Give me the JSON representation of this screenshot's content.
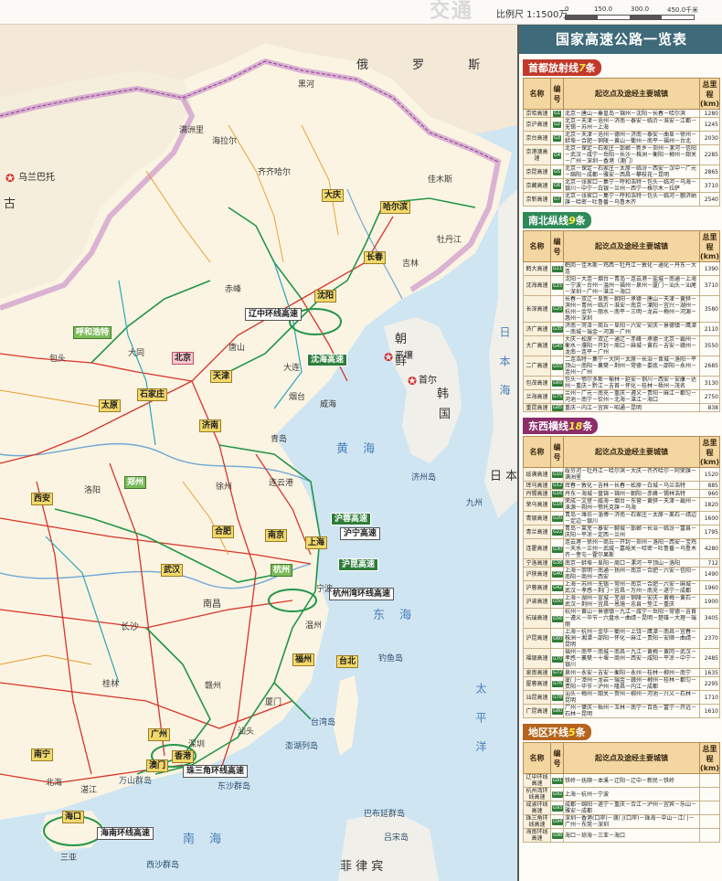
{
  "header": {
    "scale_label": "比例尺 1:1500万",
    "scale_ticks": [
      "0",
      "150.0",
      "300.0",
      "450.0千米"
    ],
    "ghost_text": "交通"
  },
  "map": {
    "countries": [
      {
        "id": "russia",
        "text": "俄 罗 斯"
      },
      {
        "id": "mongolia_fragment",
        "text": "古"
      },
      {
        "id": "korea_n",
        "text": "朝"
      },
      {
        "id": "korea_n2",
        "text": "鲜"
      },
      {
        "id": "korea_s",
        "text": "韩"
      },
      {
        "id": "korea_s2",
        "text": "国"
      },
      {
        "id": "philippines",
        "text": "菲 律 宾"
      },
      {
        "id": "japan_frag",
        "text": "日 本"
      }
    ],
    "seas": [
      {
        "id": "yellow_sea",
        "text": "黄 海"
      },
      {
        "id": "east_sea",
        "text": "东 海"
      },
      {
        "id": "south_sea",
        "text": "南 海"
      },
      {
        "id": "pacific",
        "text": "太 平 洋"
      },
      {
        "id": "japan_sea",
        "text": "日 本 海"
      }
    ],
    "capitals": [
      {
        "id": "ulaanbaatar",
        "text": "乌兰巴托"
      },
      {
        "id": "pyongyang",
        "text": "平壤"
      },
      {
        "id": "seoul",
        "text": "首尔"
      }
    ],
    "cities_boxed": [
      {
        "id": "harbin",
        "text": "哈尔滨"
      },
      {
        "id": "changchun",
        "text": "长春"
      },
      {
        "id": "shenyang",
        "text": "沈阳"
      },
      {
        "id": "huhehaote",
        "text": "呼和浩特"
      },
      {
        "id": "beijing",
        "text": "北京"
      },
      {
        "id": "tianjin",
        "text": "天津"
      },
      {
        "id": "shijiazhuang",
        "text": "石家庄"
      },
      {
        "id": "taiyuan",
        "text": "太原"
      },
      {
        "id": "jinan",
        "text": "济南"
      },
      {
        "id": "zhengzhou",
        "text": "郑州"
      },
      {
        "id": "xian",
        "text": "西安"
      },
      {
        "id": "hefei",
        "text": "合肥"
      },
      {
        "id": "nanjing",
        "text": "南京"
      },
      {
        "id": "shanghai",
        "text": "上海"
      },
      {
        "id": "hangzhou",
        "text": "杭州"
      },
      {
        "id": "wuhan",
        "text": "武汉"
      },
      {
        "id": "nanchang",
        "text": "南昌"
      },
      {
        "id": "changsha",
        "text": "长沙"
      },
      {
        "id": "fuzhou",
        "text": "福州"
      },
      {
        "id": "taibei",
        "text": "台北"
      },
      {
        "id": "guangzhou",
        "text": "广州"
      },
      {
        "id": "hongkong",
        "text": "香港"
      },
      {
        "id": "macau",
        "text": "澳门"
      },
      {
        "id": "nanning",
        "text": "南宁"
      },
      {
        "id": "haikou",
        "text": "海口"
      },
      {
        "id": "daqing",
        "text": "大庆"
      },
      {
        "id": "dalian",
        "text": "大连"
      },
      {
        "id": "qingdao",
        "text": "青岛"
      }
    ],
    "expressways": [
      {
        "id": "huyu",
        "text": "沪蓉高速"
      },
      {
        "id": "huning",
        "text": "沪宁高速"
      },
      {
        "id": "hukun",
        "text": "沪昆高速"
      },
      {
        "id": "hzwan",
        "text": "杭州湾环线高速"
      },
      {
        "id": "liaozhong",
        "text": "辽中环线高速"
      },
      {
        "id": "zhusanjiao",
        "text": "珠三角环线高速"
      },
      {
        "id": "hainan",
        "text": "海南环线高速"
      },
      {
        "id": "shenhai",
        "text": "沈海高速"
      }
    ],
    "places": [
      {
        "id": "heihe",
        "text": "黑河"
      },
      {
        "id": "qiqihaer",
        "text": "齐齐哈尔"
      },
      {
        "id": "manzhouli",
        "text": "满洲里"
      },
      {
        "id": "hailaer",
        "text": "海拉尔"
      },
      {
        "id": "jiamusi",
        "text": "佳木斯"
      },
      {
        "id": "mudanjiang",
        "text": "牡丹江"
      },
      {
        "id": "jilin",
        "text": "吉林"
      },
      {
        "id": "chifeng",
        "text": "赤峰"
      },
      {
        "id": "baotou",
        "text": "包头"
      },
      {
        "id": "datong",
        "text": "大同"
      },
      {
        "id": "tangshan",
        "text": "唐山"
      },
      {
        "id": "yantai",
        "text": "烟台"
      },
      {
        "id": "weihai",
        "text": "威海"
      },
      {
        "id": "lianyungang",
        "text": "连云港"
      },
      {
        "id": "xuzhou",
        "text": "徐州"
      },
      {
        "id": "luoyang",
        "text": "洛阳"
      },
      {
        "id": "ningbo",
        "text": "宁波"
      },
      {
        "id": "wenzhou",
        "text": "温州"
      },
      {
        "id": "xiamen",
        "text": "厦门"
      },
      {
        "id": "shantou",
        "text": "汕头"
      },
      {
        "id": "shenzhen",
        "text": "深圳"
      },
      {
        "id": "zhanjiang",
        "text": "湛江"
      },
      {
        "id": "beihai",
        "text": "北海"
      },
      {
        "id": "guilin",
        "text": "桂林"
      },
      {
        "id": "ganzhou",
        "text": "赣州"
      },
      {
        "id": "taiwan_island",
        "text": "台湾岛"
      },
      {
        "id": "penghu",
        "text": "澎湖列岛"
      },
      {
        "id": "dongsha",
        "text": "东沙群岛"
      },
      {
        "id": "wanshan",
        "text": "万山群岛"
      },
      {
        "id": "xisha",
        "text": "西沙群岛"
      },
      {
        "id": "lvsong",
        "text": "吕宋岛"
      },
      {
        "id": "diaoyu",
        "text": "钓鱼岛"
      },
      {
        "id": "jeju",
        "text": "济州岛"
      },
      {
        "id": "jiuzhou",
        "text": "九州"
      },
      {
        "id": "sanya",
        "text": "三亚"
      },
      {
        "id": "baliss",
        "text": "巴布延群岛"
      }
    ]
  },
  "panel": {
    "title": "国家高速公路一览表",
    "columns": {
      "name": "名称",
      "code": "编号",
      "route": "起讫点及途经主要城镇",
      "length": "总里程(km)"
    },
    "sections": [
      {
        "id": "radial",
        "head_prefix": "首都放射线",
        "head_count": "7",
        "head_suffix": "条",
        "rows": [
          {
            "name": "京哈高速",
            "code": "G1",
            "route": "北京－唐山－秦皇岛－锦州－沈阳－长春－哈尔滨",
            "length": "1280"
          },
          {
            "name": "京沪高速",
            "code": "G2",
            "route": "北京－天津－沧州－济南－泰安－临沂－淮安－江都－无锡－苏州－上海",
            "length": "1245"
          },
          {
            "name": "京台高速",
            "code": "G3",
            "route": "北京－天津－沧州－德州－济南－泰安－曲阜－徐州－蚌埠－合肥－铜陵－黄山－衢州－南平－福州－台北",
            "length": "2030"
          },
          {
            "name": "京港澳高速",
            "code": "G4",
            "route": "北京－保定－石家庄－邯郸－新乡－郑州－漯河－信阳－武汉－咸宁－岳阳－长沙－株洲－衡阳－郴州－韶关－广州－深圳－香港（澳门）",
            "length": "2285"
          },
          {
            "name": "京昆高速",
            "code": "G5",
            "route": "北京－保定－石家庄－太原－临汾－西安－汉中－广元－绵阳－成都－雅安－西昌－攀枝花－昆明",
            "length": "2865"
          },
          {
            "name": "京藏高速",
            "code": "G6",
            "route": "北京－张家口－集宁－呼和浩特－包头－临河－乌海－银川－中宁－白银－兰州－西宁－格尔木－拉萨",
            "length": "3710"
          },
          {
            "name": "京新高速",
            "code": "G7",
            "route": "北京－张家口－集宁－呼和浩特－包头－临河－额济纳旗－哈密－吐鲁番－乌鲁木齐",
            "length": "2540"
          }
        ]
      },
      {
        "id": "ns",
        "head_prefix": "南北纵线",
        "head_count": "9",
        "head_suffix": "条",
        "rows": [
          {
            "name": "鹤大高速",
            "code": "G11",
            "route": "鹤岗－佳木斯－鸡西－牡丹江－敦化－通化－丹东－大连",
            "length": "1390"
          },
          {
            "name": "沈海高速",
            "code": "G15",
            "route": "沈阳－大连－烟台－青岛－连云港－盐城－南通－上海－宁波－台州－温州－福州－泉州－厦门－汕头－汕尾－深圳－广州－湛江－海口",
            "length": "3710"
          },
          {
            "name": "长深高速",
            "code": "G25",
            "route": "长春－双辽－阜新－朝阳－承德－唐山－天津－黄骅－滨州－青州－临沂－淮安－南京－溧阳－宜兴－湖州－杭州－金华－丽水－南平－三明－龙岩－梅州－河源－惠州－深圳",
            "length": "3580"
          },
          {
            "name": "济广高速",
            "code": "G35",
            "route": "济南－菏泽－商丘－阜阳－六安－安庆－景德镇－鹰潭－南城－瑞金－河源－广州",
            "length": "2110"
          },
          {
            "name": "大广高速",
            "code": "G45",
            "route": "大庆－松原－双辽－通辽－赤峰－承德－北京－霸州－衡水－濮阳－开封－周口－麻城－黄石－吉安－赣州－龙南－连平－广州",
            "length": "3550"
          },
          {
            "name": "二广高速",
            "code": "G55",
            "route": "二连浩特－集宁－大同－太原－长治－晋城－洛阳－平顶山－南阳－襄樊－荆州－常德－娄底－邵阳－永州－连州－广州",
            "length": "2685"
          },
          {
            "name": "包茂高速",
            "code": "G65",
            "route": "包头－鄂尔多斯－榆林－延安－铜川－西安－安康－达州－重庆－黔江－吉首－怀化－桂林－梧州－茂名",
            "length": "3130"
          },
          {
            "name": "兰海高速",
            "code": "G75",
            "route": "兰州－广元－南充－重庆－遵义－贵阳－麻江－都匀－河池－南宁－钦州－北海－湛江－海口",
            "length": "2750"
          },
          {
            "name": "重昆高速",
            "code": "G85",
            "route": "重庆－内江－宜宾－昭通－昆明",
            "length": "838"
          }
        ]
      },
      {
        "id": "ew",
        "head_prefix": "东西横线",
        "head_count": "18",
        "head_suffix": "条",
        "rows": [
          {
            "name": "绥满高速",
            "code": "G10",
            "route": "绥芬河－牡丹江－哈尔滨－大庆－齐齐哈尔－阿荣旗－满洲里",
            "length": "1520"
          },
          {
            "name": "珲乌高速",
            "code": "G12",
            "route": "珲春－敦化－吉林－长春－松原－白城－乌兰浩特",
            "length": "885"
          },
          {
            "name": "丹锡高速",
            "code": "G16",
            "route": "丹东－海城－盘锦－锦州－朝阳－赤峰－锡林浩特",
            "length": "960"
          },
          {
            "name": "荣乌高速",
            "code": "G18",
            "route": "荣成－文登－威海－烟台－东营－黄骅－天津－霸州－涞源－朔州－鄂托克旗－乌海",
            "length": "1820"
          },
          {
            "name": "青银高速",
            "code": "G20",
            "route": "青岛－潍坊－淄博－济南－石家庄－太原－离石－靖边－定边－银川",
            "length": "1600"
          },
          {
            "name": "青兰高速",
            "code": "G22",
            "route": "青岛－莱芜－泰安－聊城－邯郸－长治－临汾－富县－庆阳－平凉－定西－兰州",
            "length": "1795"
          },
          {
            "name": "连霍高速",
            "code": "G30",
            "route": "连云港－徐州－商丘－开封－郑州－洛阳－西安－宝鸡－天水－兰州－武威－嘉峪关－哈密－吐鲁番－乌鲁木齐－奎屯－霍尔果斯",
            "length": "4280"
          },
          {
            "name": "宁洛高速",
            "code": "G36",
            "route": "南京－蚌埠－阜阳－周口－漯河－平顶山－洛阳",
            "length": "712"
          },
          {
            "name": "沪陕高速",
            "code": "G40",
            "route": "上海－崇明－南通－扬州－南京－合肥－六安－信阳－南阳－商州－西安",
            "length": "1490"
          },
          {
            "name": "沪蓉高速",
            "code": "G42",
            "route": "上海－苏州－无锡－常州－南京－合肥－六安－麻城－武汉－孝感－荆门－宜昌－万州－南充－遂宁－成都",
            "length": "1960"
          },
          {
            "name": "沪渝高速",
            "code": "G50",
            "route": "上海－湖州－宣城－芜湖－铜陵－安庆－黄梅－黄石－武汉－荆州－宜昌－恩施－忠县－垫江－重庆",
            "length": "1900"
          },
          {
            "name": "杭瑞高速",
            "code": "G56",
            "route": "杭州－黄山－景德镇－九江－咸宁－岳阳－常德－吉首－遵义－毕节－六盘水－曲靖－昆明－楚雄－大理－瑞丽",
            "length": "3405"
          },
          {
            "name": "沪昆高速",
            "code": "G60",
            "route": "上海－杭州－金华－衢州－上饶－鹰潭－南昌－宜春－株洲－湘潭－邵阳－怀化－麻江－贵阳－安顺－曲靖－昆明",
            "length": "2370"
          },
          {
            "name": "福银高速",
            "code": "G70",
            "route": "福州－南平－南城－南昌－九江－黄梅－黄冈－武汉－孝感－襄樊－十堰－商州－西安－咸阳－平凉－中宁－银川",
            "length": "2485"
          },
          {
            "name": "泉南高速",
            "code": "G72",
            "route": "泉州－永安－吉安－衡阳－永州－桂林－柳州－南宁",
            "length": "1635"
          },
          {
            "name": "厦蓉高速",
            "code": "G76",
            "route": "厦门－漳州－龙岩－瑞金－赣州－郴州－桂林－都匀－贵阳－毕节－泸州－隆昌－内江－成都",
            "length": "2295"
          },
          {
            "name": "汕昆高速",
            "code": "G78",
            "route": "汕头－梅州－韶关－贺州－柳州－河池－兴义－石林－昆明",
            "length": "1710"
          },
          {
            "name": "广昆高速",
            "code": "G80",
            "route": "广州－肇庆－梧州－玉林－南宁－百色－富宁－开远－石林－昆明",
            "length": "1610"
          }
        ]
      },
      {
        "id": "ring",
        "head_prefix": "地区环线",
        "head_count": "5",
        "head_suffix": "条",
        "rows": [
          {
            "name": "辽中环线高速",
            "code": "G91",
            "route": "铁岭－抚顺－本溪－辽阳－辽中－新民－铁岭",
            "length": ""
          },
          {
            "name": "杭州湾环线高速",
            "code": "G92",
            "route": "上海－杭州－宁波",
            "length": ""
          },
          {
            "name": "成渝环线高速",
            "code": "G93",
            "route": "成都－绵阳－遂宁－重庆－合江－泸州－宜宾－乐山－雅安－成都",
            "length": ""
          },
          {
            "name": "珠三角环线高速",
            "code": "G94",
            "route": "深圳－香港(口岸)－澳门(口岸)－珠海－中山－江门－广州－东莞－深圳",
            "length": ""
          },
          {
            "name": "海南环线高速",
            "code": "G98",
            "route": "海口－琼海－三亚－海口",
            "length": ""
          }
        ]
      }
    ]
  }
}
